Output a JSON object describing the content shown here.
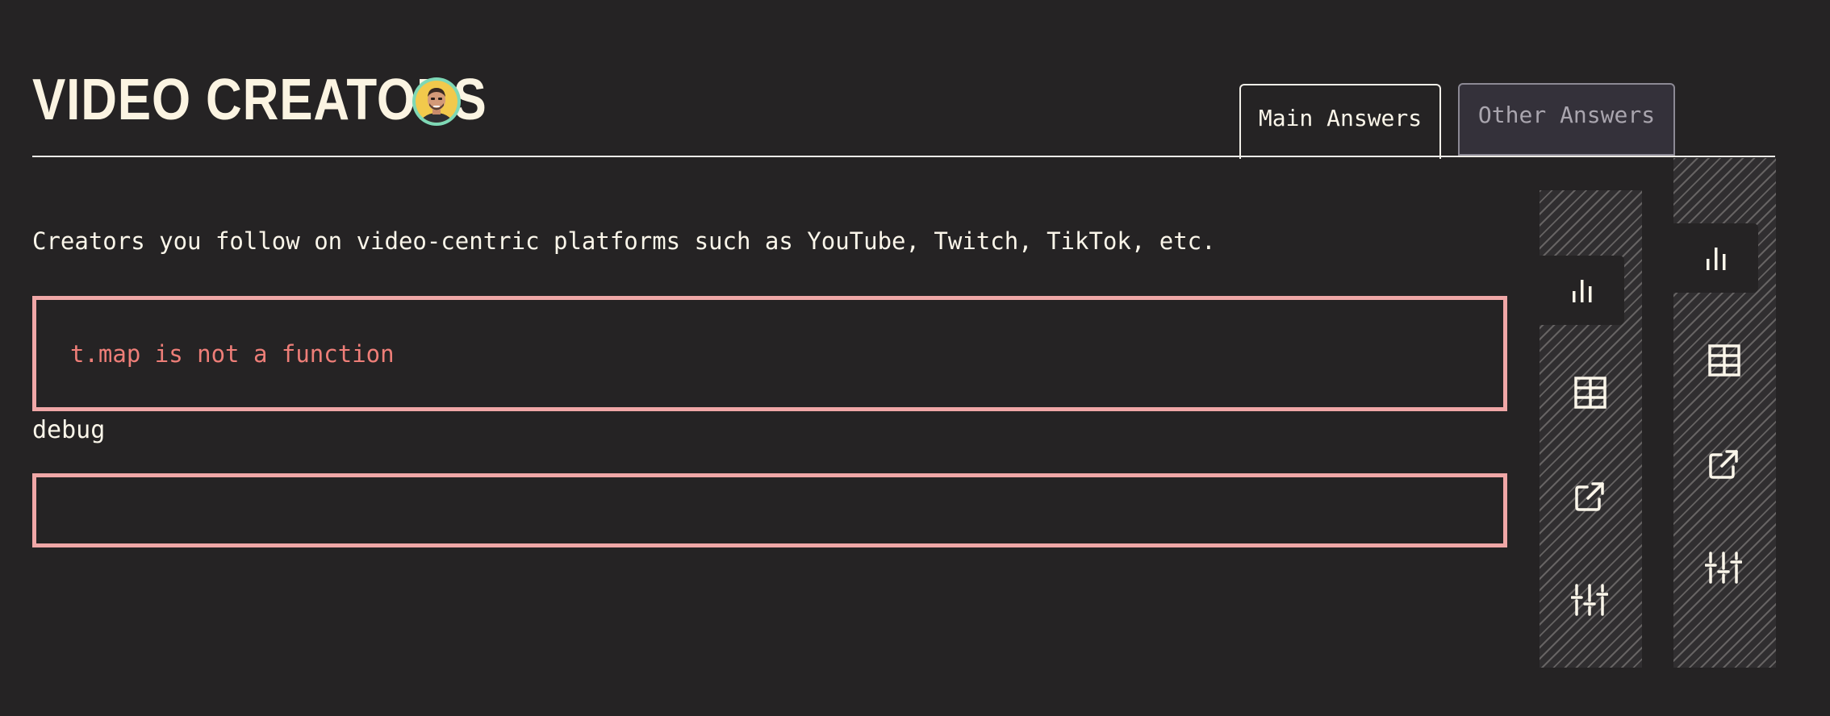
{
  "header": {
    "title": "VIDEO CREATORS"
  },
  "tabs": {
    "main": "Main Answers",
    "other": "Other Answers"
  },
  "main": {
    "description": "Creators you follow on video-centric platforms such as YouTube, Twitch, TikTok, etc.",
    "error_message": "t.map is not a function",
    "debug_label": "debug"
  },
  "sidebar_panels": [
    {
      "buttons": [
        "bar-chart-icon",
        "table-icon",
        "external-link-icon",
        "sliders-icon"
      ],
      "active": "bar-chart-icon"
    },
    {
      "buttons": [
        "bar-chart-icon",
        "table-icon",
        "external-link-icon",
        "sliders-icon"
      ],
      "active": "bar-chart-icon"
    }
  ],
  "colors": {
    "background": "#252324",
    "text": "#fbf6ea",
    "error_border": "#f0a7a7",
    "error_text": "#ee7e78",
    "avatar_ring": "#7ed8b6",
    "inactive_tab_bg": "#34313a"
  }
}
